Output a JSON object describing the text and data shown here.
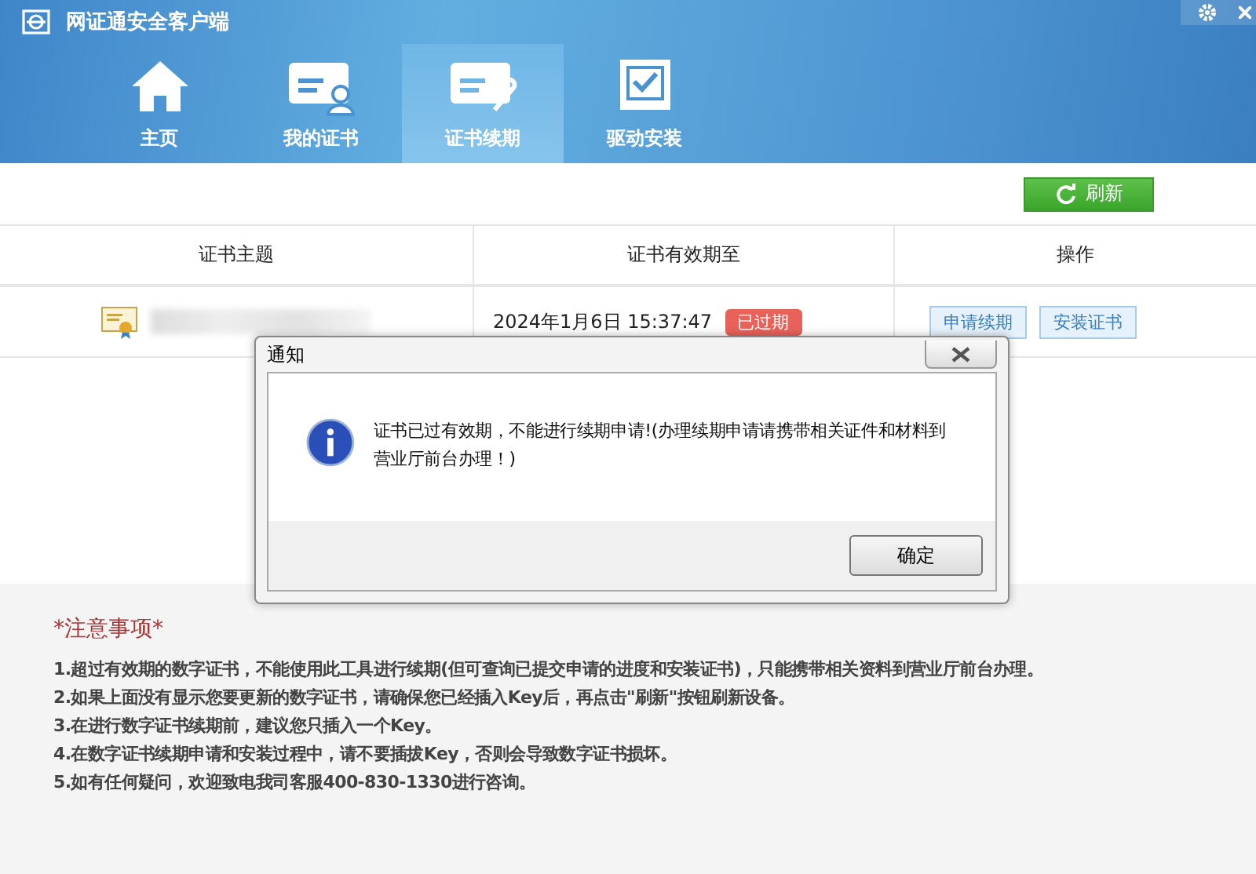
{
  "window": {
    "title": "网证通安全客户端"
  },
  "tabs": [
    {
      "label": "主页",
      "kind": "home",
      "selected": false
    },
    {
      "label": "我的证书",
      "kind": "cert-user",
      "selected": false
    },
    {
      "label": "证书续期",
      "kind": "cert-clip",
      "selected": true
    },
    {
      "label": "驱动安装",
      "kind": "check-box",
      "selected": false
    }
  ],
  "toolbar": {
    "refresh": "刷新"
  },
  "table": {
    "columns": [
      "证书主题",
      "证书有效期至",
      "操作"
    ],
    "rows": [
      {
        "valid_until": "2024年1月6日 15:37:47",
        "status": "已过期",
        "actions": [
          "申请续期",
          "安装证书"
        ]
      }
    ]
  },
  "dialog": {
    "title": "通知",
    "message": "证书已过有效期，不能进行续期申请!(办理续期申请请携带相关证件和材料到营业厅前台办理！)",
    "ok": "确定"
  },
  "notes": {
    "title": "*注意事项*",
    "items": [
      "1.超过有效期的数字证书，不能使用此工具进行续期(但可查询已提交申请的进度和安装证书)，只能携带相关资料到营业厅前台办理。",
      "2.如果上面没有显示您要更新的数字证书，请确保您已经插入Key后，再点击\"刷新\"按钮刷新设备。",
      "3.在进行数字证书续期前，建议您只插入一个Key。",
      "4.在数字证书续期申请和安装过程中，请不要插拔Key，否则会导致数字证书损坏。",
      "5.如有任何疑问，欢迎致电我司客服400-830-1330进行咨询。"
    ]
  }
}
